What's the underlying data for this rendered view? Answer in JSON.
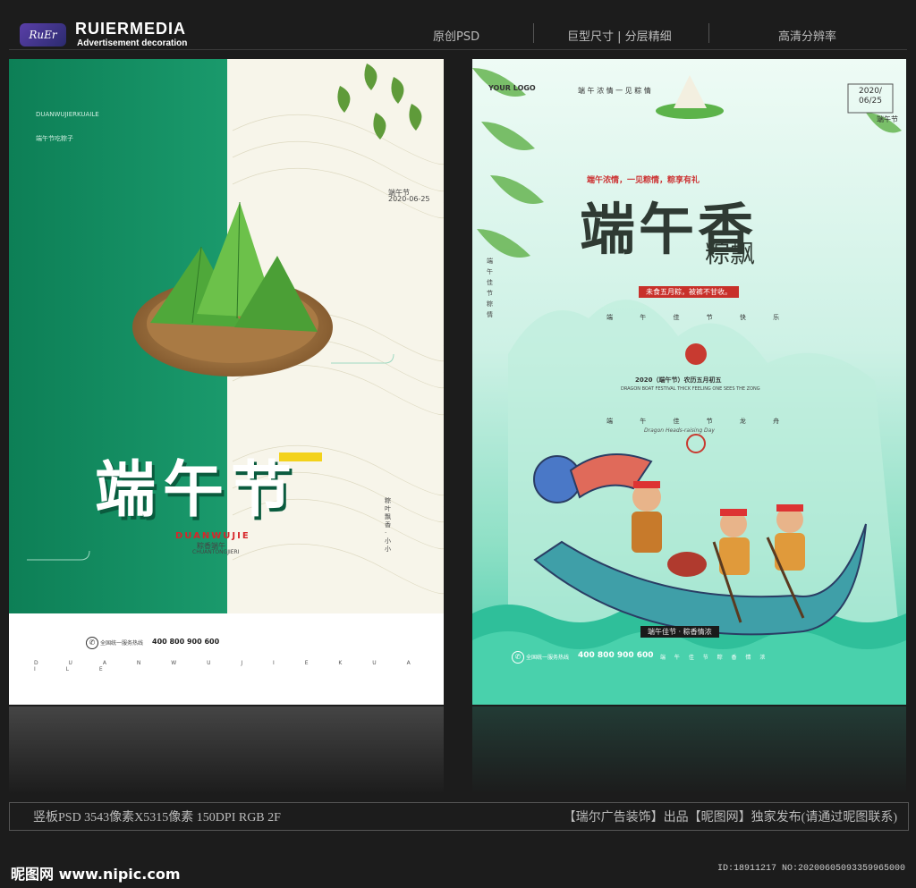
{
  "header": {
    "logo_badge": "RuEr",
    "brand_name": "RUIERMEDIA",
    "brand_tagline": "Advertisement decoration",
    "items": [
      "原创PSD",
      "巨型尺寸 | 分层精细",
      "高清分辨率"
    ]
  },
  "poster_left": {
    "title": "端午节",
    "top_text": "DUANWUJIERKUAILE",
    "top_sub": "端午节吃粽子",
    "date_label": "端午节",
    "date": "2020-06-25",
    "pinyin_red": "DUANWUJIE",
    "subtitle": "粽香端午",
    "subtitle_en": "CHUANTONGJIERI",
    "side_small": "粽叶飘香·小小",
    "phone": "400 800 900 600",
    "hotline_label": "全国统一服务热线",
    "bottom_letters": "D U A N W U J I E K U A I L E",
    "colors": {
      "green": "#0f8a5f",
      "yellow": "#f3d21b"
    }
  },
  "poster_right": {
    "logo": "YOUR LOGO",
    "date": "2020/ 06/25",
    "top_line": "端 午 浓 情    一 见 粽 情",
    "slogan": "端午浓情，一见粽情，粽享有礼",
    "title_main": "端午香",
    "title_sub": "粽飘",
    "red_banner": "未食五月粽，被裤不甘收。",
    "festival_line": "端 午 佳 节 快 乐",
    "date_line": "2020（端午节）农历五月初五",
    "en_line": "DRAGON BOAT FESTIVAL THICK FEELING ONE SEES THE ZONG",
    "line2": "端 午 佳 节 龙 舟",
    "en_line2": "Dragon Heads-raising Day",
    "left_vert": "端午佳节粽情",
    "right_vert": "端午节",
    "bottom_banner": "端午佳节 · 粽香情浓",
    "phone": "400 800 900 600",
    "hotline_label": "全国统一服务热线",
    "bottom_small": "端 午 佳 节 粽 香 情 浓"
  },
  "footer": {
    "specs": "竖板PSD 3543像素X5315像素 150DPI RGB 2F",
    "publisher": "【瑞尔广告装饰】出品【昵图网】独家发布(请通过昵图联系)",
    "site": "昵图网 www.nipic.com",
    "id": "ID:18911217 NO:20200605093359965000"
  }
}
